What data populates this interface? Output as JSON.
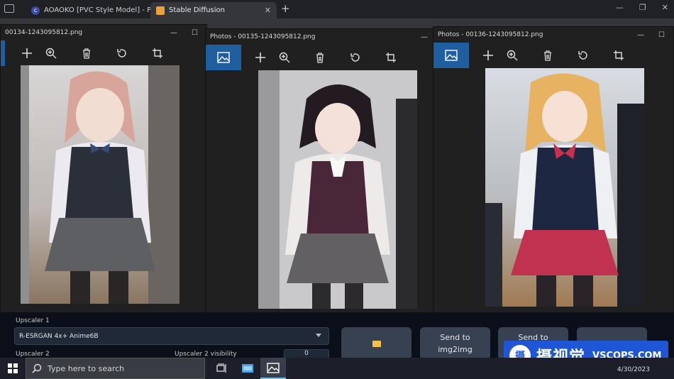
{
  "browser": {
    "tabs": [
      {
        "title": "AOAOKO [PVC Style Model] - PVC",
        "icon": "civitai-icon"
      },
      {
        "title": "Stable Diffusion",
        "icon": "stable-diffusion-icon"
      }
    ],
    "new_tab": "+"
  },
  "photos_windows": [
    {
      "title": "00134-1243095812.png"
    },
    {
      "title": "Photos - 00135-1243095812.png"
    },
    {
      "title": "Photos - 00136-1243095812.png"
    }
  ],
  "sd": {
    "upscaler1_label": "Upscaler 1",
    "upscaler1_value": "R-ESRGAN 4x+ Anime6B",
    "upscaler2_label": "Upscaler 2",
    "upscaler2_vis_label": "Upscaler 2 visibility",
    "upscaler2_vis_value": "0",
    "send_img2img_line1": "Send to",
    "send_img2img_line2": "img2img",
    "send_to_label": "Send to"
  },
  "taskbar": {
    "search_placeholder": "Type here to search",
    "date": "4/30/2023"
  },
  "watermark": {
    "seal": "摄",
    "cn": "摄视觉",
    "en": "VSCOPS.COM"
  },
  "colors": {
    "accent_blue": "#1f5fa0",
    "watermark_blue": "#1e56d6",
    "sd_bg": "#0b0f19"
  }
}
